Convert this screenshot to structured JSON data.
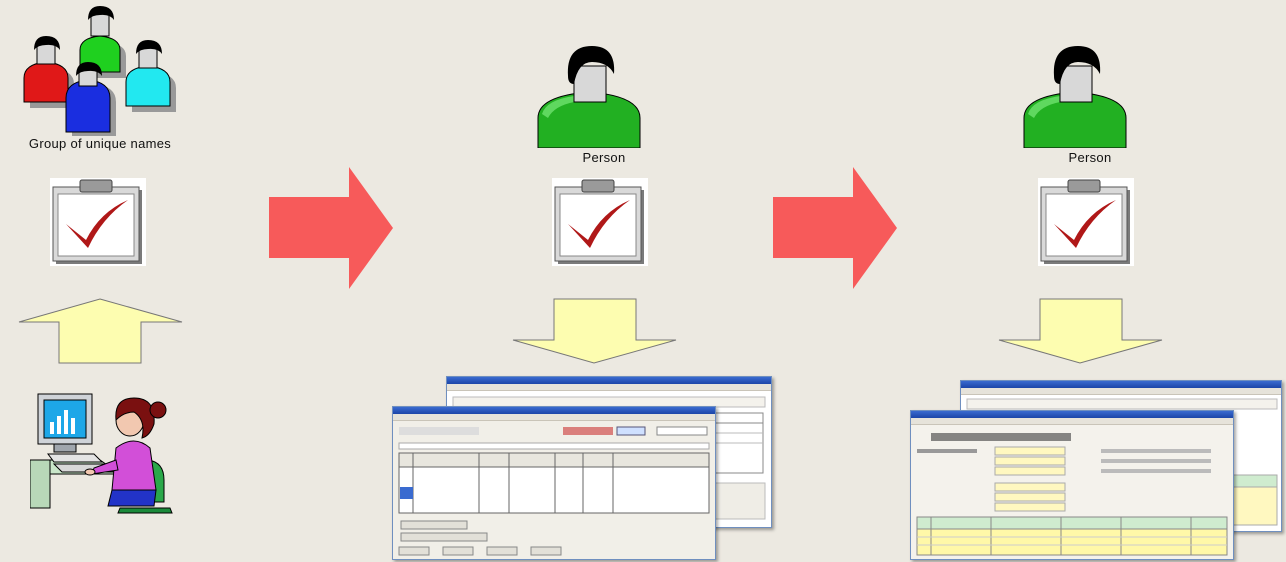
{
  "group": {
    "caption": "Group of unique names"
  },
  "person_1": {
    "caption": "Person"
  },
  "person_2": {
    "caption": "Person"
  },
  "colors": {
    "background": "#ece9e1",
    "red_arrow": "#f75a5a",
    "yellow_arrow": "#fdfdb0",
    "person_green": "#22b022",
    "check_red": "#b01818"
  },
  "icons": {
    "group": "group-of-people-icon",
    "person": "person-icon",
    "clipboard": "clipboard-check-icon",
    "computer_user": "computer-user-icon",
    "arrow_right": "red-right-arrow-icon",
    "arrow_up": "yellow-up-arrow-icon",
    "arrow_down": "yellow-down-arrow-icon"
  }
}
